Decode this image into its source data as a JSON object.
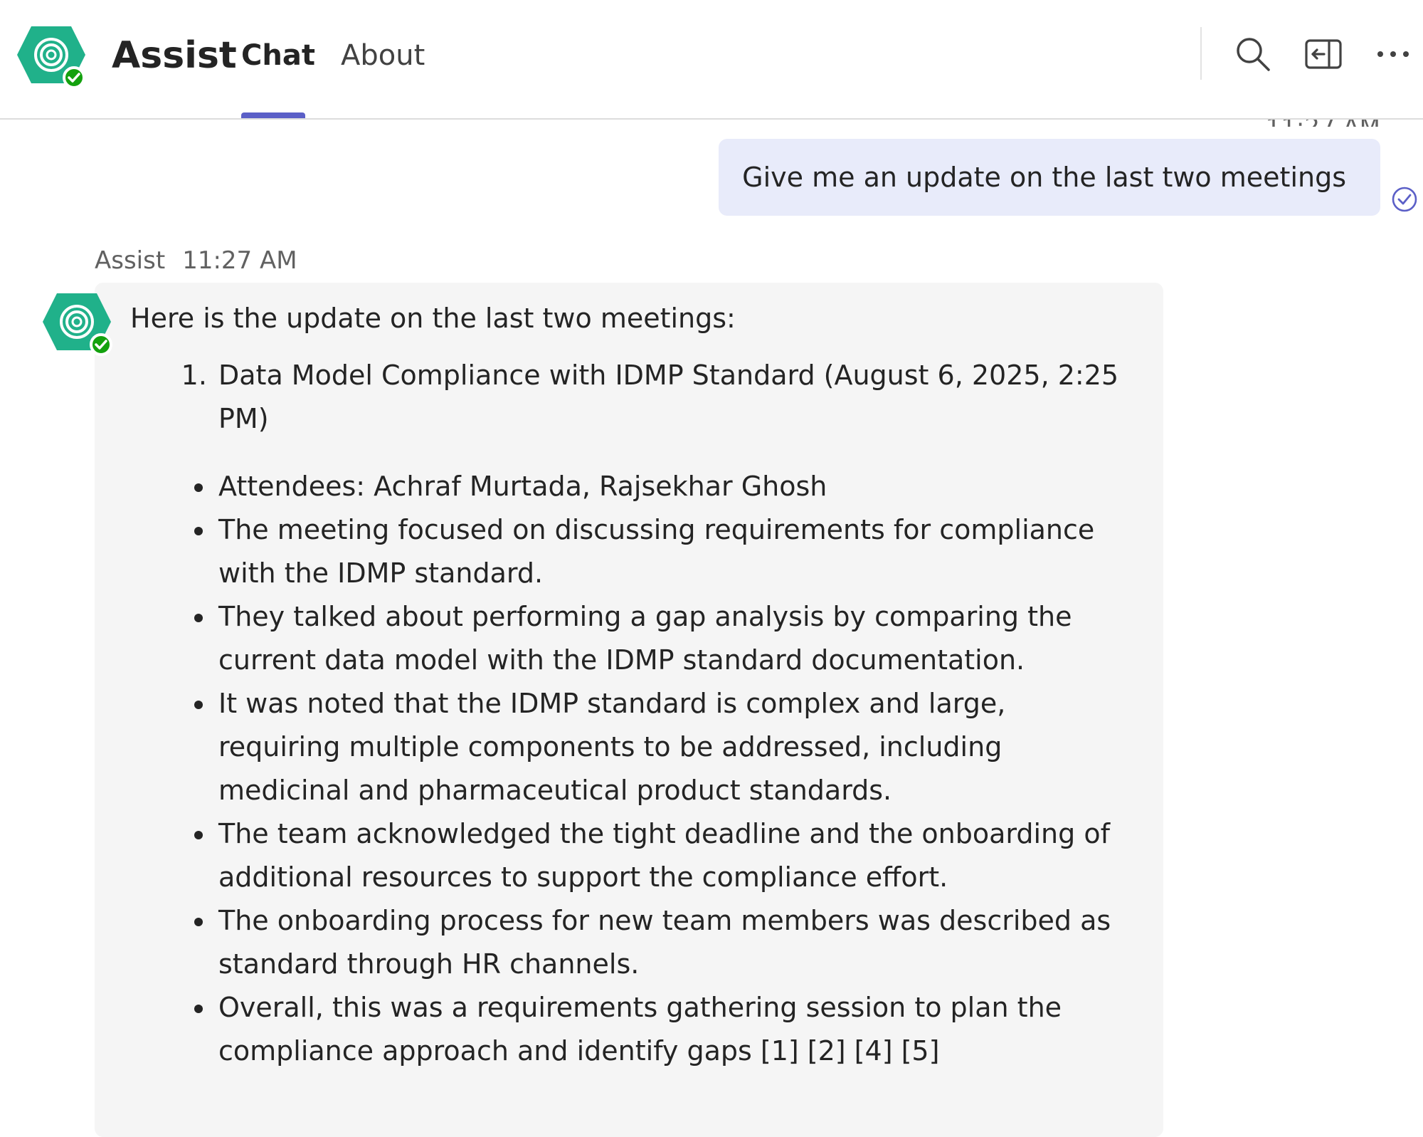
{
  "header": {
    "app_name": "Assist",
    "tabs": [
      {
        "label": "Chat",
        "active": true
      },
      {
        "label": "About",
        "active": false
      }
    ],
    "icons": [
      "search-icon",
      "side-panel-icon",
      "more-options-icon"
    ]
  },
  "chat": {
    "clipped_timestamp": "11:27 AM",
    "user_message": {
      "text": "Give me an update on the last two meetings",
      "status": "read-receipt-icon"
    },
    "bot_message": {
      "sender": "Assist",
      "time": "11:27 AM",
      "intro": "Here is the update on the last two meetings:",
      "meetings": [
        {
          "title": "Data Model Compliance with IDMP Standard (August 6, 2025, 2:25 PM)",
          "points": [
            "Attendees: Achraf Murtada, Rajsekhar Ghosh",
            "The meeting focused on discussing requirements for compliance with the IDMP standard.",
            "They talked about performing a gap analysis by comparing the current data model with the IDMP standard documentation.",
            "It was noted that the IDMP standard is complex and large, requiring multiple components to be addressed, including medicinal and pharmaceutical product standards.",
            "The team acknowledged the tight deadline and the onboarding of additional resources to support the compliance effort.",
            "The onboarding process for new team members was described as standard through HR channels.",
            "Overall, this was a requirements gathering session to plan the compliance approach and identify gaps [1] [2] [4] [5]"
          ]
        }
      ]
    }
  },
  "colors": {
    "accent": "#5b5fc7",
    "logo_green": "#20b18a",
    "presence_green": "#13a10e",
    "user_bubble": "#e8ebfa",
    "bot_bubble": "#f5f5f5"
  }
}
